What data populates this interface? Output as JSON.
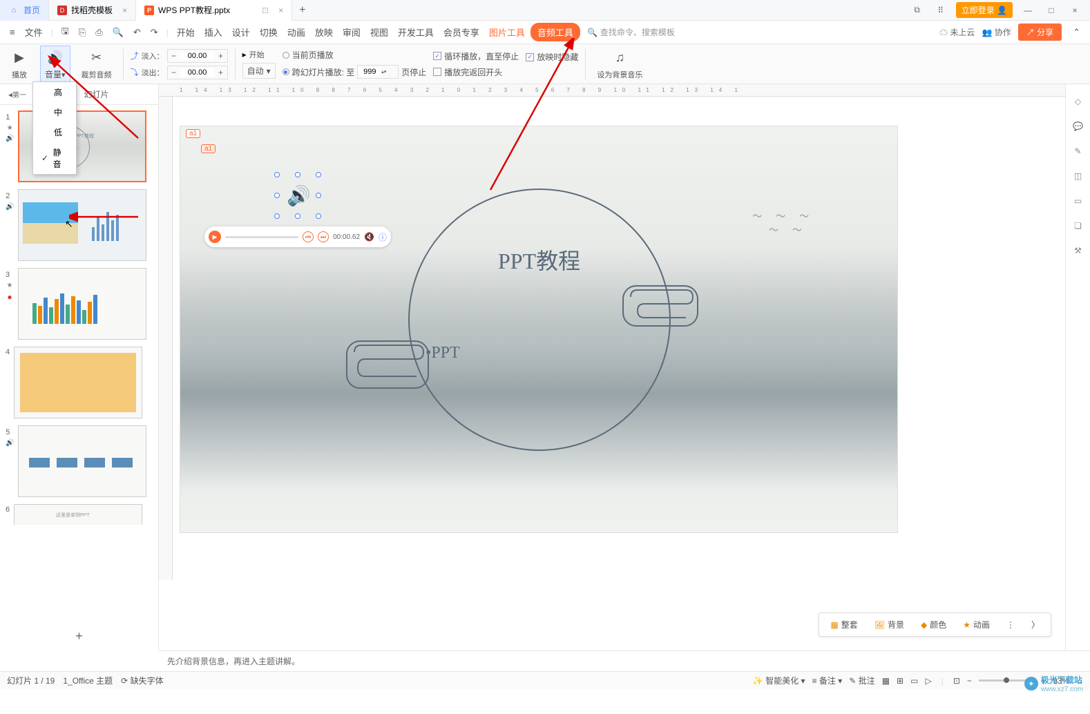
{
  "titlebar": {
    "home": "首页",
    "template_tab": "找稻壳模板",
    "doc_tab": "WPS PPT教程.pptx",
    "login": "立即登录"
  },
  "menubar": {
    "file": "文件",
    "items": [
      "开始",
      "插入",
      "设计",
      "切换",
      "动画",
      "放映",
      "审阅",
      "视图",
      "开发工具",
      "会员专享"
    ],
    "pic_tools": "图片工具",
    "audio_tools": "音频工具",
    "search_placeholder": "查找命令、搜索模板",
    "cloud": "未上云",
    "collab": "协作",
    "share": "分享"
  },
  "ribbon": {
    "play": "播放",
    "volume": "音量",
    "trim": "裁剪音频",
    "fadein": "淡入：",
    "fadeout": "淡出：",
    "fade_val": "00.00",
    "start": "开始",
    "auto": "自动",
    "current_page": "当前页播放",
    "loop": "循环播放，直至停止",
    "hide": "放映时隐藏",
    "cross": "跨幻灯片播放: 至",
    "cross_val": "999",
    "page_stop": "页停止",
    "return": "播放完返回开头",
    "bgm": "设为背景音乐"
  },
  "volume_menu": {
    "high": "高",
    "mid": "中",
    "low": "低",
    "mute": "静音"
  },
  "sidebar": {
    "tab_slides": "幻灯片",
    "section": "第一",
    "nums": [
      "1",
      "2",
      "3",
      "4",
      "5",
      "6"
    ]
  },
  "slide": {
    "title": "PPT教程",
    "subtitle": "•PPT",
    "comment1": "a1",
    "comment2": "a1",
    "player_time": "00:00.62"
  },
  "float": {
    "full": "整套",
    "bg": "背景",
    "color": "颜色",
    "anim": "动画"
  },
  "notes": "先介绍背景信息，再进入主题讲解。",
  "status": {
    "page": "幻灯片 1 / 19",
    "theme": "1_Office 主题",
    "missing_font": "缺失字体",
    "beautify": "智能美化",
    "notes_btn": "备注",
    "comment_btn": "批注",
    "zoom": "93%"
  },
  "watermark": {
    "text": "极光下载站",
    "url": "www.xz7.com"
  }
}
